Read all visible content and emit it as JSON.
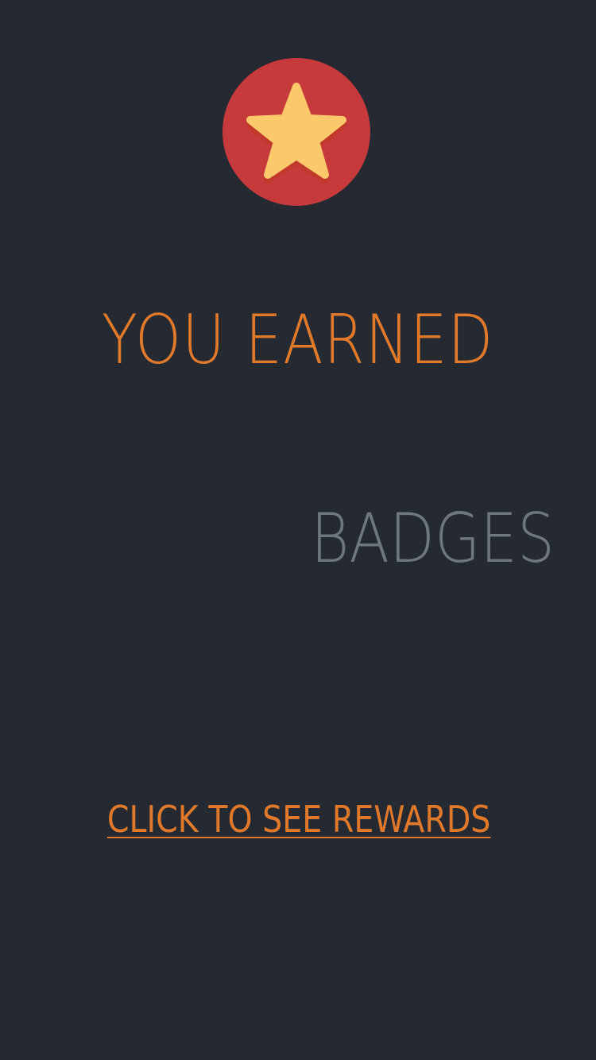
{
  "badge": {
    "icon": "star-icon",
    "circle_color": "#c63a3c",
    "star_color": "#fbc96a"
  },
  "headline": "YOU EARNED",
  "subheadline": "BADGES",
  "cta_label": "CLICK TO SEE REWARDS",
  "colors": {
    "background": "#242932",
    "accent": "#e07a2a",
    "muted": "#6e7680"
  }
}
